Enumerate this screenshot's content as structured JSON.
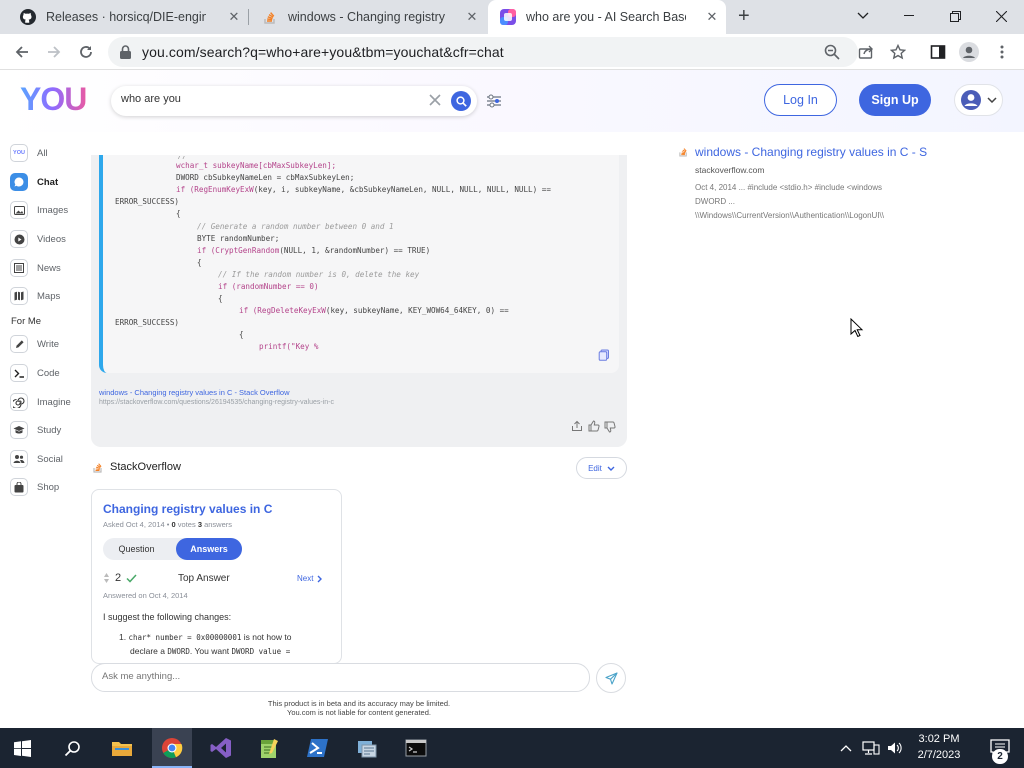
{
  "browser": {
    "tabs": [
      {
        "title": "Releases · horsicq/DIE-engine",
        "icon": "github-icon"
      },
      {
        "title": "windows - Changing registry valu",
        "icon": "stackoverflow-icon"
      },
      {
        "title": "who are you - AI Search Based C",
        "icon": "you-com-icon"
      }
    ],
    "url": "you.com/search?q=who+are+you&tbm=youchat&cfr=chat"
  },
  "header": {
    "logo": "YOU",
    "search_value": "who are you",
    "login": "Log In",
    "signup": "Sign Up"
  },
  "sidebar": {
    "items_top": [
      {
        "label": "All",
        "icon": "you-logo-icon"
      },
      {
        "label": "Chat",
        "icon": "chat-icon"
      },
      {
        "label": "Images",
        "icon": "image-icon"
      },
      {
        "label": "Videos",
        "icon": "video-icon"
      },
      {
        "label": "News",
        "icon": "news-icon"
      },
      {
        "label": "Maps",
        "icon": "map-icon"
      }
    ],
    "section_label": "For Me",
    "items_bottom": [
      {
        "label": "Write",
        "icon": "pencil-icon"
      },
      {
        "label": "Code",
        "icon": "terminal-icon"
      },
      {
        "label": "Imagine",
        "icon": "spiral-icon"
      },
      {
        "label": "Study",
        "icon": "graduation-cap-icon"
      },
      {
        "label": "Social",
        "icon": "people-icon"
      },
      {
        "label": "Shop",
        "icon": "bag-icon"
      }
    ]
  },
  "code": {
    "l1": "wchar_t subkeyName[cbMaxSubkeyLen];",
    "l2": "DWORD cbSubkeyNameLen = cbMaxSubkeyLen;",
    "l3a": "if (",
    "l3fn": "RegEnumKeyExW",
    "l3b": "(key, i, subkeyName, &cbSubkeyNameLen, NULL, NULL, NULL, NULL) ==",
    "l4": "ERROR_SUCCESS)",
    "l5": "{",
    "l6": "// Generate a random number between 0 and 1",
    "l7": "BYTE randomNumber;",
    "l8a": "if (",
    "l8fn": "CryptGenRandom",
    "l8b": "(NULL, 1, &randomNumber) == TRUE)",
    "l9": "{",
    "l10": "// If the random number is 0, delete the key",
    "l11": "if (randomNumber == 0)",
    "l12": "{",
    "l13a": "if (",
    "l13fn": "RegDeleteKeyExW",
    "l13b": "(key, subkeyName, KEY_WOW64_64KEY, 0) ==",
    "l14": "ERROR_SUCCESS)",
    "l15": "{",
    "l16": "printf(\"Key %"
  },
  "citation": {
    "title": "windows - Changing registry values in C - Stack Overflow",
    "url": "https://stackoverflow.com/questions/26194535/changing-registry-values-in-c"
  },
  "stackoverflow_block": {
    "source": "StackOverflow",
    "edit": "Edit",
    "question_title": "Changing registry values in C",
    "asked_prefix": "Asked Oct 4, 2014 •",
    "votes_num": "0",
    "votes_word": "votes",
    "answers_num": "3",
    "answers_word": "answers",
    "tab_question": "Question",
    "tab_answers": "Answers",
    "score": "2",
    "top_answer": "Top Answer",
    "next": "Next",
    "answered": "Answered on Oct 4, 2014",
    "answer_text": "I suggest the following changes:",
    "li_num": "1.",
    "li_line1_code": "char* number = 0x00000001",
    "li_line1_text": " is not how to",
    "li_line2_text": "declare a ",
    "li_line2_code": "DWORD",
    "li_line2_text2": ". You want ",
    "li_line2_code2": "DWORD value ="
  },
  "ask": {
    "placeholder": "Ask me anything..."
  },
  "disclaimer": {
    "line1": "This product is in beta and its accuracy may be limited.",
    "line2": "You.com is not liable for content generated."
  },
  "result": {
    "title": "windows - Changing registry values in C - S",
    "site": "stackoverflow.com",
    "snippet1": "Oct 4, 2014 ... #include <stdio.h> #include <windows",
    "snippet2": "DWORD ...",
    "snippet3": "\\\\Windows\\\\CurrentVersion\\\\Authentication\\\\LogonUI\\\\"
  },
  "taskbar": {
    "time": "3:02 PM",
    "date": "2/7/2023",
    "notification_count": "2",
    "apps": [
      "file-explorer-icon",
      "chrome-icon",
      "visual-studio-icon",
      "notepad-plus-plus-icon",
      "powershell-icon",
      "regedit-icon",
      "cmd-icon"
    ]
  },
  "colors": {
    "accent": "#3e66e0",
    "so_orange": "#f48024",
    "code_border": "#2ea8ec"
  }
}
